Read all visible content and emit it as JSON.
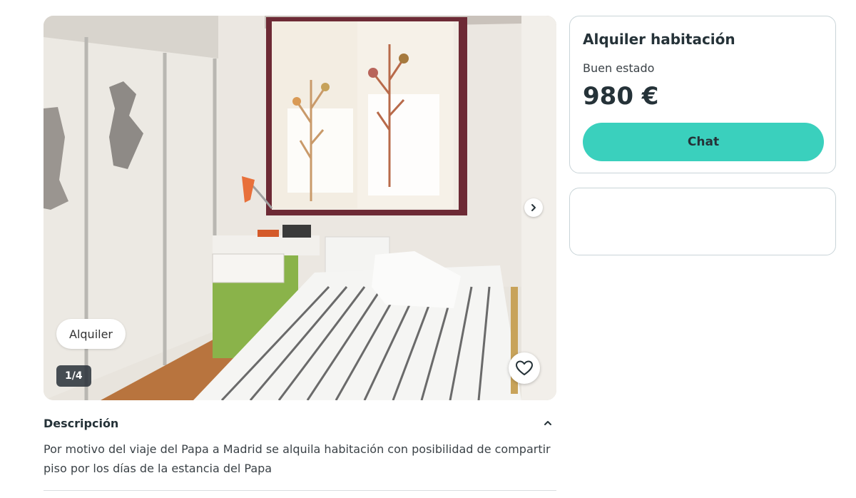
{
  "listing": {
    "gallery": {
      "type_badge": "Alquiler",
      "counter": "1/4",
      "next_icon": "chevron-right-icon",
      "favorite_icon": "heart-icon"
    },
    "description": {
      "heading": "Descripción",
      "toggle_icon": "chevron-up-icon",
      "text": "Por motivo del viaje del Papa a Madrid se alquila habitación con posibilidad de compartir piso por los días de la estancia del Papa"
    }
  },
  "card": {
    "title": "Alquiler habitación",
    "condition": "Buen estado",
    "price": "980 €",
    "chat_label": "Chat",
    "accent_color": "#3ad0bd"
  }
}
